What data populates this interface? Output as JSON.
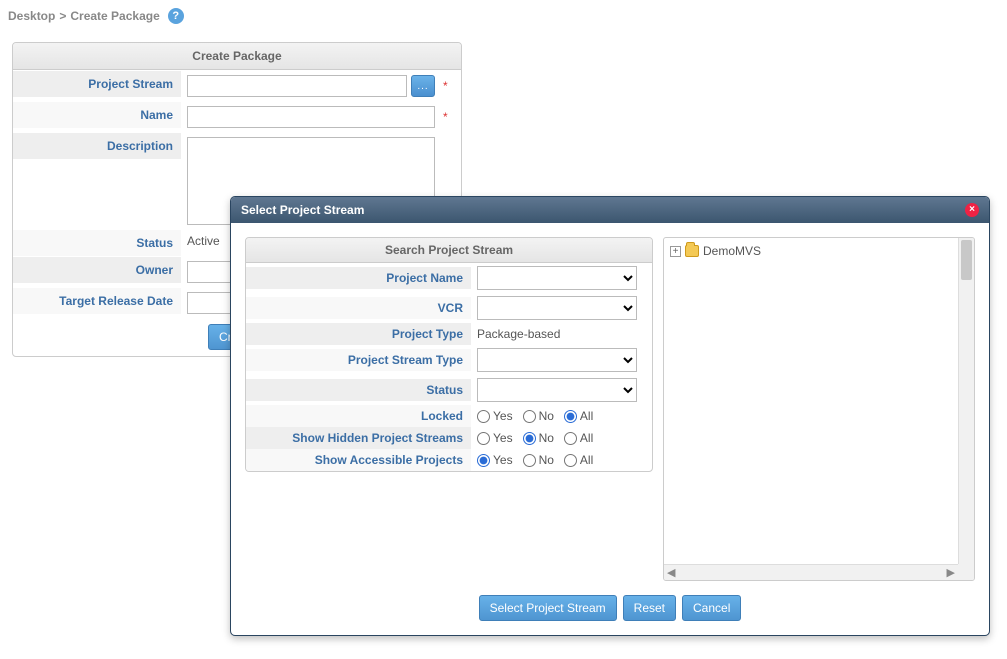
{
  "breadcrumb": {
    "root": "Desktop",
    "sep": ">",
    "current": "Create Package"
  },
  "panel": {
    "title": "Create Package",
    "labels": {
      "project_stream": "Project Stream",
      "name": "Name",
      "description": "Description",
      "status": "Status",
      "owner": "Owner",
      "target_release_date": "Target Release Date"
    },
    "values": {
      "project_stream": "",
      "name": "",
      "description": "",
      "status": "Active",
      "owner": "",
      "target_release_date": ""
    },
    "lookup_label": "...",
    "create_btn": "Create"
  },
  "dialog": {
    "title": "Select Project Stream",
    "search_title": "Search Project Stream",
    "labels": {
      "project_name": "Project Name",
      "vcr": "VCR",
      "project_type": "Project Type",
      "project_stream_type": "Project Stream Type",
      "status": "Status",
      "locked": "Locked",
      "show_hidden": "Show Hidden Project Streams",
      "show_accessible": "Show Accessible Projects"
    },
    "values": {
      "project_name": "",
      "vcr": "",
      "project_type": "Package-based",
      "project_stream_type": "",
      "status": "",
      "locked": "All",
      "show_hidden": "No",
      "show_accessible": "Yes"
    },
    "radio": {
      "yes": "Yes",
      "no": "No",
      "all": "All"
    },
    "tree": {
      "root": "DemoMVS"
    },
    "buttons": {
      "select": "Select Project Stream",
      "reset": "Reset",
      "cancel": "Cancel"
    }
  }
}
